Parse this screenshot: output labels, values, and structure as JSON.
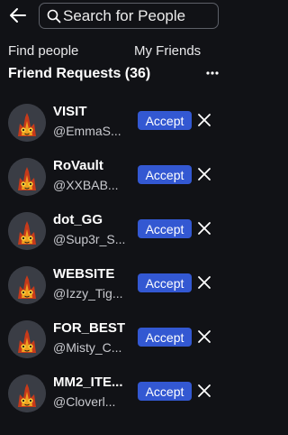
{
  "header": {
    "back_icon": "arrow-left-icon",
    "search": {
      "placeholder": "Search for People",
      "value": "",
      "icon": "search-icon"
    }
  },
  "tabs": [
    {
      "label": "Find people"
    },
    {
      "label": "My Friends"
    }
  ],
  "friend_requests": {
    "title": "Friend Requests (36)",
    "more_icon": "more-horizontal-icon",
    "accept_label": "Accept",
    "decline_icon": "close-icon",
    "items": [
      {
        "display_name": "VISIT",
        "username": "@EmmaS..."
      },
      {
        "display_name": "RoVault",
        "username": "@XXBAB..."
      },
      {
        "display_name": "dot_GG",
        "username": "@Sup3r_S..."
      },
      {
        "display_name": "WEBSITE",
        "username": "@Izzy_Tig..."
      },
      {
        "display_name": "FOR_BEST",
        "username": "@Misty_C..."
      },
      {
        "display_name": "MM2_ITE...",
        "username": "@Cloverl..."
      }
    ]
  },
  "colors": {
    "background": "#111216",
    "accept_button": "#3358d2"
  }
}
